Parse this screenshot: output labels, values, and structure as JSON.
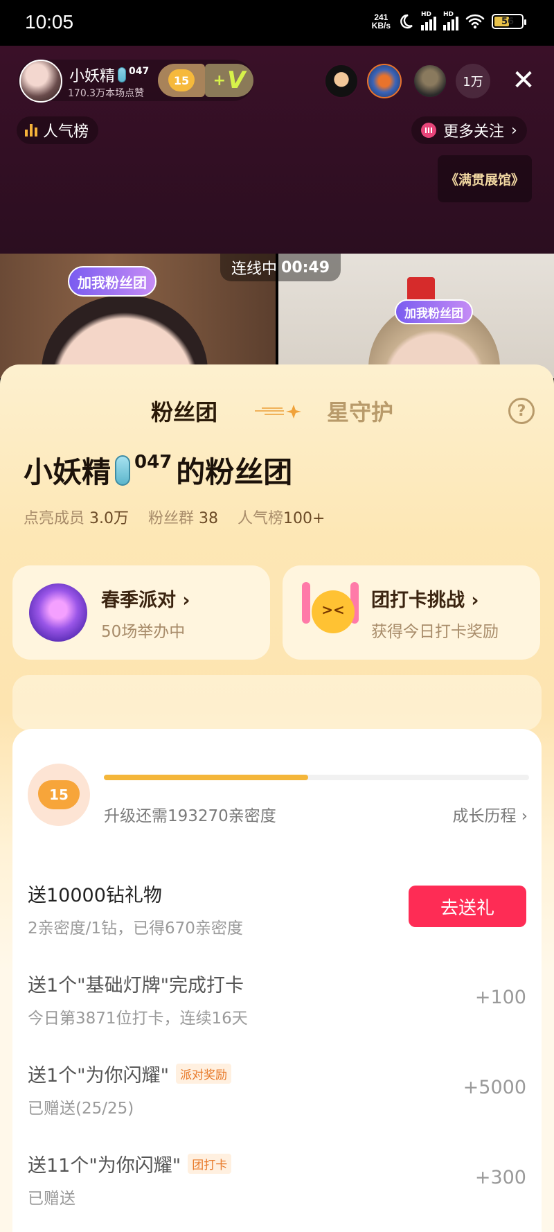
{
  "status_bar": {
    "time": "10:05",
    "net_speed_value": "241",
    "net_speed_unit": "KB/s",
    "battery": "56",
    "icons": [
      "moon-icon",
      "signal-hd-icon",
      "signal-hd-icon",
      "wifi-icon",
      "battery-icon"
    ]
  },
  "live": {
    "host_name": "小妖精",
    "host_suffix": "047",
    "host_likes": "170.3万本场点赞",
    "fan_level": "15",
    "plus_v": "V",
    "viewer_count": "1万",
    "rank_label": "人气榜",
    "follow_label": "更多关注",
    "museum_label": "《满贯展馆》",
    "link_status": "连线中",
    "link_timer": "00:49",
    "join_tag": "加我粉丝团"
  },
  "sheet": {
    "tabs": [
      {
        "label": "粉丝团"
      },
      {
        "label": "星守护"
      }
    ],
    "club_title_name": "小妖精",
    "club_title_sup": "047",
    "club_title_suffix": "的粉丝团",
    "stats": [
      {
        "label": "点亮成员",
        "value": "3.0万"
      },
      {
        "label": "粉丝群",
        "value": "38"
      },
      {
        "label": "人气榜",
        "value": "100+"
      }
    ],
    "cards": [
      {
        "title": "春季派对",
        "sub": "50场举办中"
      },
      {
        "title": "团打卡挑战",
        "sub": "获得今日打卡奖励"
      }
    ],
    "level": {
      "value": "15",
      "progress_fraction": 0.48,
      "need_text": "升级还需193270亲密度",
      "history_label": "成长历程"
    },
    "tasks": [
      {
        "name": "送10000钻礼物",
        "desc": "2亲密度/1钻，已得670亲密度",
        "button": "去送礼"
      },
      {
        "name": "送1个\"基础灯牌\"完成打卡",
        "desc": "今日第3871位打卡，连续16天",
        "points": "+100"
      },
      {
        "name": "送1个\"为你闪耀\"",
        "tag": "派对奖励",
        "desc": "已赠送(25/25)",
        "points": "+5000"
      },
      {
        "name": "送11个\"为你闪耀\"",
        "tag": "团打卡",
        "desc": "已赠送",
        "points": "+300"
      }
    ]
  },
  "colors": {
    "accent_red": "#fe2c55",
    "progress": "#f4b63a",
    "sheet_bg": "#fde7b5"
  }
}
